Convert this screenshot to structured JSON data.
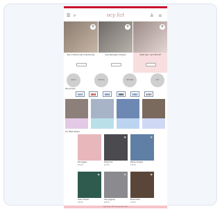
{
  "header": {
    "logo_text": "ocy lizt",
    "menu_icon": "☰",
    "search_icon": "⌕",
    "account_icon": "♙",
    "bag_icon": "⌂"
  },
  "hero": [
    {
      "caption": "Buy 2 T-Shirts & Get A Free Kids Tee",
      "colors": [
        "#8a7b70",
        "#c8b7a6"
      ]
    },
    {
      "caption": "Shop New Season Knitwear",
      "colors": [
        "#6e6a66",
        "#b8b2ab"
      ]
    },
    {
      "caption": "Winter Sale - Up To 50% Off",
      "colors": [
        "#9c8a86",
        "#e3d6d3"
      ]
    }
  ],
  "categories": [
    "NEW IN",
    "DRESSES",
    "KNITWEAR",
    "KIDS"
  ],
  "shop_by": {
    "title": "Shop Prints"
  },
  "prints": [
    {
      "colors": [
        "#7384a3",
        "#d9e0ec"
      ]
    },
    {
      "colors": [
        "#c0392b",
        "#e8b4b0"
      ]
    },
    {
      "colors": [
        "#4a6fa5",
        "#d0dcef"
      ]
    },
    {
      "colors": [
        "#2c3e50",
        "#aeb8c4"
      ]
    },
    {
      "colors": [
        "#3f6fae",
        "#dbe4f2"
      ]
    },
    {
      "colors": [
        "#555555",
        "#ffffff"
      ]
    }
  ],
  "tiles": [
    {
      "img": "#8d7f79",
      "band": "#e3c9e6"
    },
    {
      "img": "#a7b3c7",
      "band": "#b9e0e9"
    },
    {
      "img": "#6d88b2",
      "band": "#bcd4f0"
    },
    {
      "img": "#7a6a5e",
      "band": "#cfd8f5"
    }
  ],
  "new_arrivals_title": "Our Best Sellers",
  "products": [
    {
      "name": "Pink Joggers",
      "price": "£24.00",
      "color": "#e8b7bc"
    },
    {
      "name": "Striped Top",
      "price": "£22.00",
      "color": "#4b4a4f"
    },
    {
      "name": "Ribbed Cardigan",
      "price": "£30.00",
      "color": "#5f7fa5"
    },
    {
      "name": "Green Trousers",
      "price": "£26.00",
      "color": "#2f5a4e"
    },
    {
      "name": "Grey Leggings",
      "price": "£20.00",
      "color": "#8a8a8f"
    },
    {
      "name": "Brown Dress",
      "price": "£34.00",
      "color": "#5a4638"
    }
  ],
  "footer_text": "Sign up for 10% off your first order",
  "colors": {
    "accent": "#c8102e",
    "footer": "#f6c3c9"
  }
}
